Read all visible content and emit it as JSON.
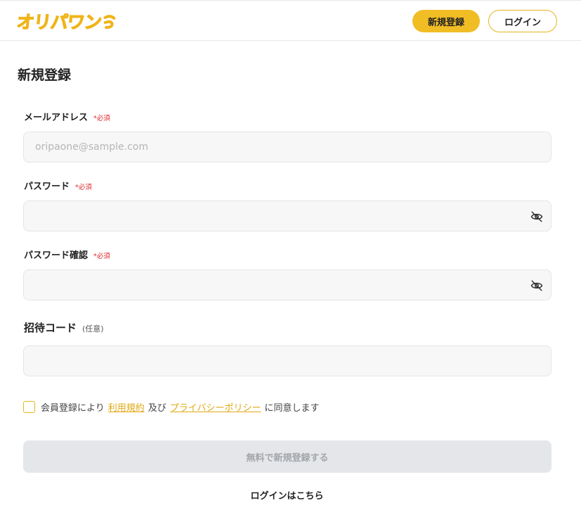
{
  "header": {
    "logo_text": "オリパワン",
    "signup_label": "新規登録",
    "login_label": "ログイン"
  },
  "page": {
    "title": "新規登録"
  },
  "form": {
    "email": {
      "label": "メールアドレス",
      "required": "*必須",
      "placeholder": "oripaone@sample.com",
      "value": ""
    },
    "password": {
      "label": "パスワード",
      "required": "*必須",
      "value": "",
      "toggle_icon": "eye-off-icon"
    },
    "password_confirm": {
      "label": "パスワード確認",
      "required": "*必須",
      "value": "",
      "toggle_icon": "eye-off-icon"
    },
    "invite_code": {
      "label": "招待コード",
      "optional": "(任意)",
      "value": ""
    },
    "agreement": {
      "checked": false,
      "text_before": "会員登録により",
      "terms_link": "利用規約",
      "conjunction": "及び",
      "privacy_link": "プライバシーポリシー",
      "text_after": "に同意します"
    },
    "submit_label": "無料で新規登録する",
    "login_link": "ログインはこちら"
  },
  "colors": {
    "brand": "#f1bd24",
    "required": "#e02a2a",
    "link": "#e0a812",
    "disabled_button": "#e4e6e9"
  }
}
